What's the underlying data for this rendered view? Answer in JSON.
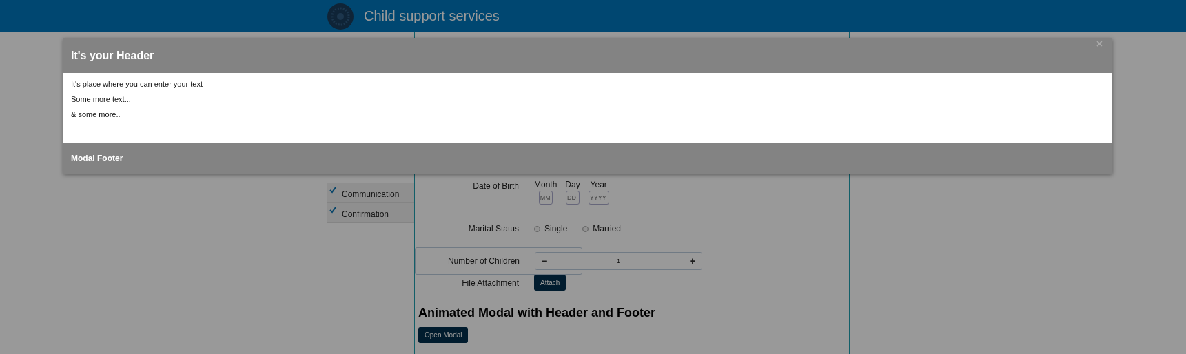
{
  "app_header": {
    "title": "Child support services"
  },
  "sidebar": {
    "items": [
      {
        "label": "Communication",
        "checked": true
      },
      {
        "label": "Confirmation",
        "checked": true
      }
    ]
  },
  "form": {
    "rows": [
      {
        "kind": "date",
        "label": "Date of Birth",
        "parts": [
          {
            "caption": "Month",
            "placeholder": "MM"
          },
          {
            "caption": "Day",
            "placeholder": "DD"
          },
          {
            "caption": "Year",
            "placeholder": "YYYY"
          }
        ]
      },
      {
        "kind": "radio",
        "label": "Marital Status",
        "options": [
          {
            "label": "Single",
            "selected": false
          },
          {
            "label": "Married",
            "selected": false
          }
        ]
      },
      {
        "kind": "stepper",
        "label": "Number of Children",
        "minus": "−",
        "value": "1",
        "plus": "+"
      },
      {
        "kind": "button",
        "label": "File Attachment",
        "button": "Attach"
      }
    ]
  },
  "section": {
    "heading": "Animated Modal with Header and Footer",
    "button": "Open Modal"
  },
  "modal": {
    "title": "It's your Header",
    "close": "×",
    "body": [
      "It's place where you can enter your text",
      "Some more text...",
      "& some more.."
    ],
    "footer": "Modal Footer"
  }
}
